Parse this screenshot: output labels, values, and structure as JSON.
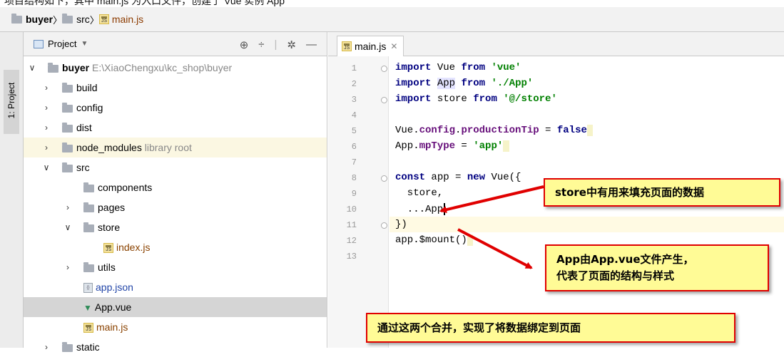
{
  "top_strip_text": "项目结构如下，其中 main.js 为入口文件，创建了 Vue 实例 App",
  "breadcrumb": {
    "project": "buyer",
    "folder": "src",
    "file": "main.js"
  },
  "side_tool_window": {
    "label": "1: Project"
  },
  "project_panel": {
    "title": "Project",
    "tree": [
      {
        "label": "buyer",
        "extra": "E:\\XiaoChengxu\\kc_shop\\buyer",
        "type": "root"
      },
      {
        "label": "build",
        "type": "folder"
      },
      {
        "label": "config",
        "type": "folder"
      },
      {
        "label": "dist",
        "type": "folder"
      },
      {
        "label": "node_modules",
        "extra": "library root",
        "type": "folder"
      },
      {
        "label": "src",
        "type": "folder"
      },
      {
        "label": "components",
        "type": "folder"
      },
      {
        "label": "pages",
        "type": "folder"
      },
      {
        "label": "store",
        "type": "folder"
      },
      {
        "label": "index.js",
        "type": "js"
      },
      {
        "label": "utils",
        "type": "folder"
      },
      {
        "label": "app.json",
        "type": "json"
      },
      {
        "label": "App.vue",
        "type": "vue"
      },
      {
        "label": "main.js",
        "type": "js"
      },
      {
        "label": "static",
        "type": "folder"
      }
    ]
  },
  "editor": {
    "tab_label": "main.js",
    "line_numbers": [
      "1",
      "2",
      "3",
      "4",
      "5",
      "6",
      "7",
      "8",
      "9",
      "10",
      "11",
      "12",
      "13"
    ],
    "code": {
      "l1_kw": "import",
      "l1_a": " Vue ",
      "l1_kw2": "from",
      "l1_str": "'vue'",
      "l2_kw": "import",
      "l2_a": "App",
      "l2_kw2": "from",
      "l2_str": "'./App'",
      "l3_kw": "import",
      "l3_a": " store ",
      "l3_kw2": "from",
      "l3_str": "'@/store'",
      "l5_a": "Vue.",
      "l5_prop": "config",
      "l5_b": ".",
      "l5_prop2": "productionTip",
      "l5_c": " = ",
      "l5_kw": "false",
      "l6_a": "App.",
      "l6_prop": "mpType",
      "l6_c": " = ",
      "l6_str": "'app'",
      "l8_kw": "const",
      "l8_a": " app = ",
      "l8_kw2": "new",
      "l8_b": " Vue({",
      "l9": "  store,",
      "l10": "  ...App",
      "l11": "})",
      "l12": "app.$mount()"
    }
  },
  "annotations": {
    "note1": "store中有用来填充页面的数据",
    "note2_line1": "App由App.vue文件产生，",
    "note2_line2": "代表了页面的结构与样式",
    "note3": "通过这两个合并，实现了将数据绑定到页面"
  },
  "colors": {
    "note_fill": "#fffb96",
    "note_border": "#e00000",
    "arrow": "#e00000",
    "keyword": "#000080",
    "string": "#008000",
    "property": "#660e7a"
  }
}
